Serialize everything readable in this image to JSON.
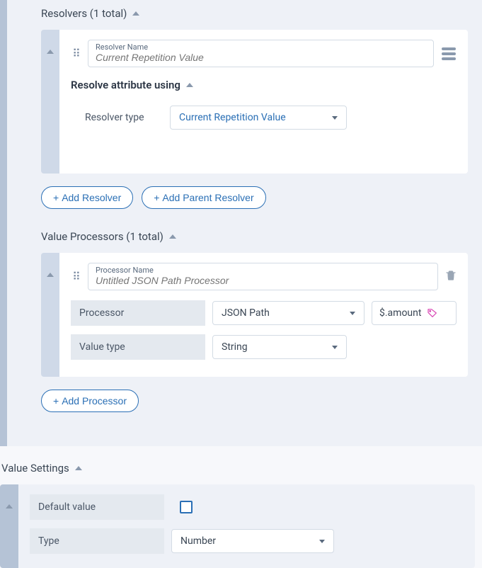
{
  "resolvers": {
    "header": "Resolvers (1 total)",
    "item": {
      "name_label": "Resolver Name",
      "name_placeholder": "Current Repetition Value",
      "sub_header": "Resolve attribute using",
      "type_label": "Resolver type",
      "type_value": "Current Repetition Value"
    },
    "add_btn": "Add Resolver",
    "add_parent_btn": "Add Parent Resolver"
  },
  "processors": {
    "header": "Value Processors (1 total)",
    "item": {
      "name_label": "Processor Name",
      "name_placeholder": "Untitled JSON Path Processor",
      "processor_label": "Processor",
      "processor_value": "JSON Path",
      "path_value": "$.amount",
      "value_type_label": "Value type",
      "value_type_value": "String"
    },
    "add_btn": "Add Processor"
  },
  "settings": {
    "header": "Value Settings",
    "default_label": "Default value",
    "default_checked": false,
    "type_label": "Type",
    "type_value": "Number"
  }
}
